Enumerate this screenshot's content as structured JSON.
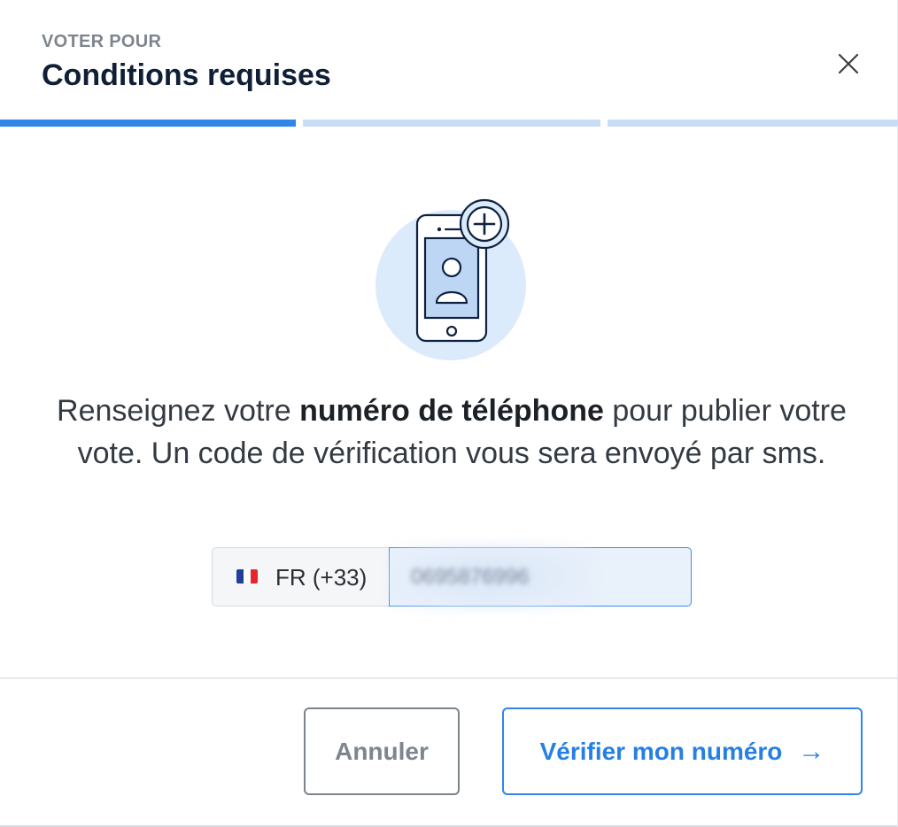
{
  "header": {
    "eyebrow": "VOTER POUR",
    "title": "Conditions requises"
  },
  "progress": {
    "steps_total": 3,
    "current_step": 1
  },
  "message": {
    "before": "Renseignez votre ",
    "bold": "numéro de téléphone",
    "after": " pour publier votre vote. Un code de vérification vous sera envoyé par sms."
  },
  "phone": {
    "country_code": "FR (+33)",
    "number": "0695876996",
    "flag_colors": [
      "#1f3f99",
      "#ffffff",
      "#e4262f"
    ]
  },
  "footer": {
    "cancel_label": "Annuler",
    "verify_label": "Vérifier mon numéro",
    "verify_arrow": "→"
  },
  "colors": {
    "primary": "#2f86e8",
    "progress_inactive": "#c8def6",
    "title": "#0e1f36"
  }
}
